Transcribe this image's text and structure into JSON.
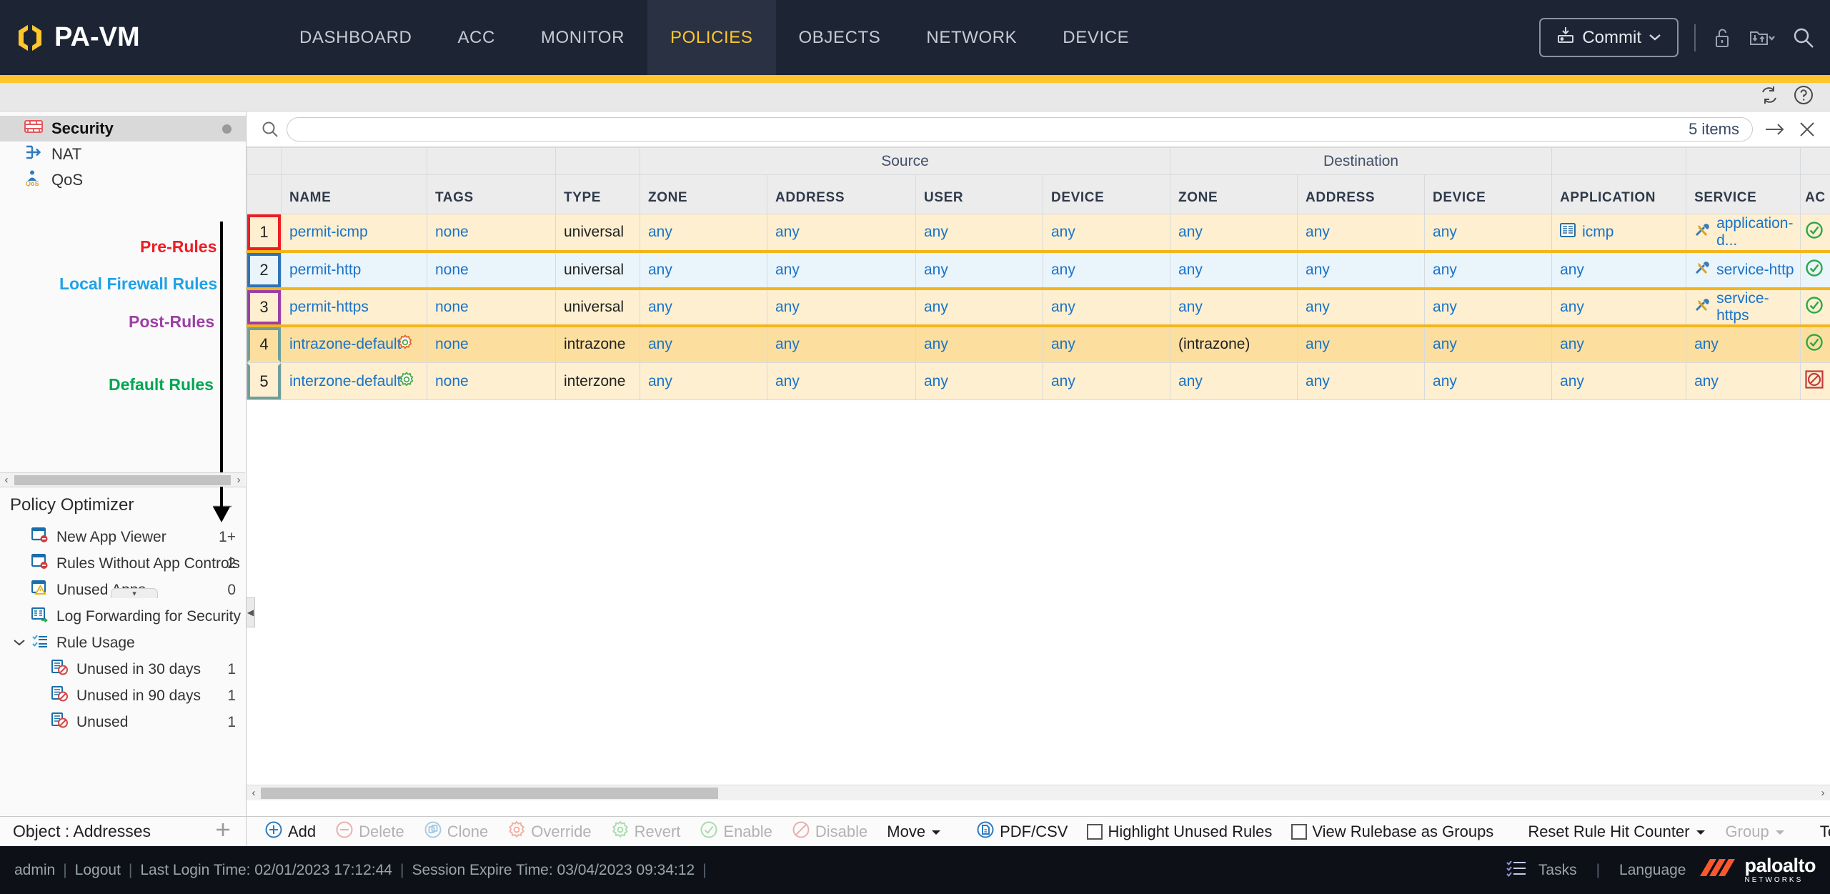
{
  "header": {
    "brand": "PA-VM",
    "tabs": [
      {
        "label": "DASHBOARD",
        "active": false
      },
      {
        "label": "ACC",
        "active": false
      },
      {
        "label": "MONITOR",
        "active": false
      },
      {
        "label": "POLICIES",
        "active": true
      },
      {
        "label": "OBJECTS",
        "active": false
      },
      {
        "label": "NETWORK",
        "active": false
      },
      {
        "label": "DEVICE",
        "active": false
      }
    ],
    "commit_label": "Commit",
    "icons": [
      "commit-icon",
      "unlock-icon",
      "config-transfer-icon",
      "search-icon"
    ]
  },
  "subbar": {
    "icons": [
      "refresh-icon",
      "help-icon"
    ]
  },
  "sidebar": {
    "policy_types": [
      {
        "label": "Security",
        "icon": "security-policy-icon",
        "selected": true
      },
      {
        "label": "NAT",
        "icon": "nat-icon",
        "selected": false
      },
      {
        "label": "QoS",
        "icon": "qos-icon",
        "selected": false
      }
    ],
    "annotations": [
      {
        "label": "Pre-Rules",
        "color": "#ee1d23"
      },
      {
        "label": "Local Firewall Rules",
        "color": "#1fa2e8"
      },
      {
        "label": "Post-Rules",
        "color": "#9c3fa5"
      },
      {
        "label": "Default Rules",
        "color": "#00a651"
      }
    ],
    "optimizer": {
      "title": "Policy Optimizer",
      "collapse_label": "—",
      "items": [
        {
          "label": "New App Viewer",
          "count": "1+",
          "icon": "new-app-viewer-icon",
          "sub": false
        },
        {
          "label": "Rules Without App Controls",
          "count": "2",
          "icon": "rules-without-app-controls-icon",
          "sub": false
        },
        {
          "label": "Unused Apps",
          "count": "0",
          "icon": "unused-apps-icon",
          "sub": false
        },
        {
          "label": "Log Forwarding for Security Ser",
          "count": "",
          "icon": "log-forwarding-icon",
          "sub": false
        },
        {
          "label": "Rule Usage",
          "count": "",
          "icon": "rule-usage-icon",
          "sub": false,
          "caret": true
        },
        {
          "label": "Unused in 30 days",
          "count": "1",
          "icon": "unused-rule-icon",
          "sub": true
        },
        {
          "label": "Unused in 90 days",
          "count": "1",
          "icon": "unused-rule-icon",
          "sub": true
        },
        {
          "label": "Unused",
          "count": "1",
          "icon": "unused-rule-icon",
          "sub": true
        }
      ]
    }
  },
  "search": {
    "value": "",
    "placeholder": "",
    "items_label": "5 items"
  },
  "table": {
    "group_headers": [
      {
        "label": "Source",
        "span": 4
      },
      {
        "label": "Destination",
        "span": 3
      }
    ],
    "columns": [
      "NAME",
      "TAGS",
      "TYPE",
      "ZONE",
      "ADDRESS",
      "USER",
      "DEVICE",
      "ZONE",
      "ADDRESS",
      "DEVICE",
      "APPLICATION",
      "SERVICE",
      "AC"
    ],
    "rows": [
      {
        "num": "1",
        "name": "permit-icmp",
        "tags": "none",
        "type": "universal",
        "src_zone": "any",
        "src_address": "any",
        "src_user": "any",
        "src_device": "any",
        "dst_zone": "any",
        "dst_address": "any",
        "dst_device": "any",
        "application": "icmp",
        "app_icon": "application-group-icon",
        "service": "application-d...",
        "service_icon": "service-icon",
        "action": "allow",
        "bg": "r-yellow",
        "box_color": "#ee1d23"
      },
      {
        "num": "2",
        "name": "permit-http",
        "tags": "none",
        "type": "universal",
        "src_zone": "any",
        "src_address": "any",
        "src_user": "any",
        "src_device": "any",
        "dst_zone": "any",
        "dst_address": "any",
        "dst_device": "any",
        "application": "any",
        "app_icon": "",
        "service": "service-http",
        "service_icon": "service-icon",
        "action": "allow",
        "bg": "r-blue",
        "box_color": "#2f72b5"
      },
      {
        "num": "3",
        "name": "permit-https",
        "tags": "none",
        "type": "universal",
        "src_zone": "any",
        "src_address": "any",
        "src_user": "any",
        "src_device": "any",
        "dst_zone": "any",
        "dst_address": "any",
        "dst_device": "any",
        "application": "any",
        "app_icon": "",
        "service": "service-https",
        "service_icon": "service-icon",
        "action": "allow",
        "bg": "r-yellow",
        "box_color": "#9c3fa5"
      },
      {
        "num": "4",
        "name": "intrazone-default",
        "tags": "none",
        "type": "intrazone",
        "src_zone": "any",
        "src_address": "any",
        "src_user": "any",
        "src_device": "any",
        "dst_zone": "(intrazone)",
        "dst_address": "any",
        "dst_device": "any",
        "application": "any",
        "app_icon": "",
        "service": "any",
        "service_icon": "",
        "action": "allow",
        "bg": "r-yellow2",
        "box_color": "#6f9e9a",
        "gear": "green"
      },
      {
        "num": "5",
        "name": "interzone-default",
        "tags": "none",
        "type": "interzone",
        "src_zone": "any",
        "src_address": "any",
        "src_user": "any",
        "src_device": "any",
        "dst_zone": "any",
        "dst_address": "any",
        "dst_device": "any",
        "application": "any",
        "app_icon": "",
        "service": "any",
        "service_icon": "",
        "action": "deny",
        "bg": "r-yellow",
        "box_color": "#6f9e9a",
        "gear": "green"
      }
    ]
  },
  "object_bar": {
    "label": "Object : Addresses",
    "add_icon": "plus-icon"
  },
  "toolbar": {
    "buttons": [
      {
        "label": "Add",
        "icon": "plus-circle-icon",
        "enabled": true
      },
      {
        "label": "Delete",
        "icon": "minus-circle-icon",
        "enabled": false
      },
      {
        "label": "Clone",
        "icon": "clone-icon",
        "enabled": false
      },
      {
        "label": "Override",
        "icon": "override-icon",
        "enabled": false
      },
      {
        "label": "Revert",
        "icon": "revert-icon",
        "enabled": false
      },
      {
        "label": "Enable",
        "icon": "check-circle-icon",
        "enabled": false
      },
      {
        "label": "Disable",
        "icon": "disable-circle-icon",
        "enabled": false
      },
      {
        "label": "Move",
        "icon": "chevron-down-icon",
        "enabled": true,
        "dropdown": true
      }
    ],
    "pdf_csv": {
      "label": "PDF/CSV",
      "icon": "pdf-icon"
    },
    "checkboxes": [
      {
        "label": "Highlight Unused Rules",
        "checked": false
      },
      {
        "label": "View Rulebase as Groups",
        "checked": false
      }
    ],
    "right_buttons": [
      {
        "label": "Reset Rule Hit Counter",
        "enabled": true,
        "dropdown": true
      },
      {
        "label": "Group",
        "enabled": false,
        "dropdown": true
      },
      {
        "label": "Test Policy Match",
        "enabled": true,
        "dropdown": false
      }
    ]
  },
  "status": {
    "user": "admin",
    "logout": "Logout",
    "last_login": "Last Login Time: 02/01/2023 17:12:44",
    "session_expire": "Session Expire Time: 03/04/2023 09:34:12",
    "tasks": "Tasks",
    "language": "Language",
    "vendor": "paloalto",
    "vendor_sub": "NETWORKS"
  }
}
